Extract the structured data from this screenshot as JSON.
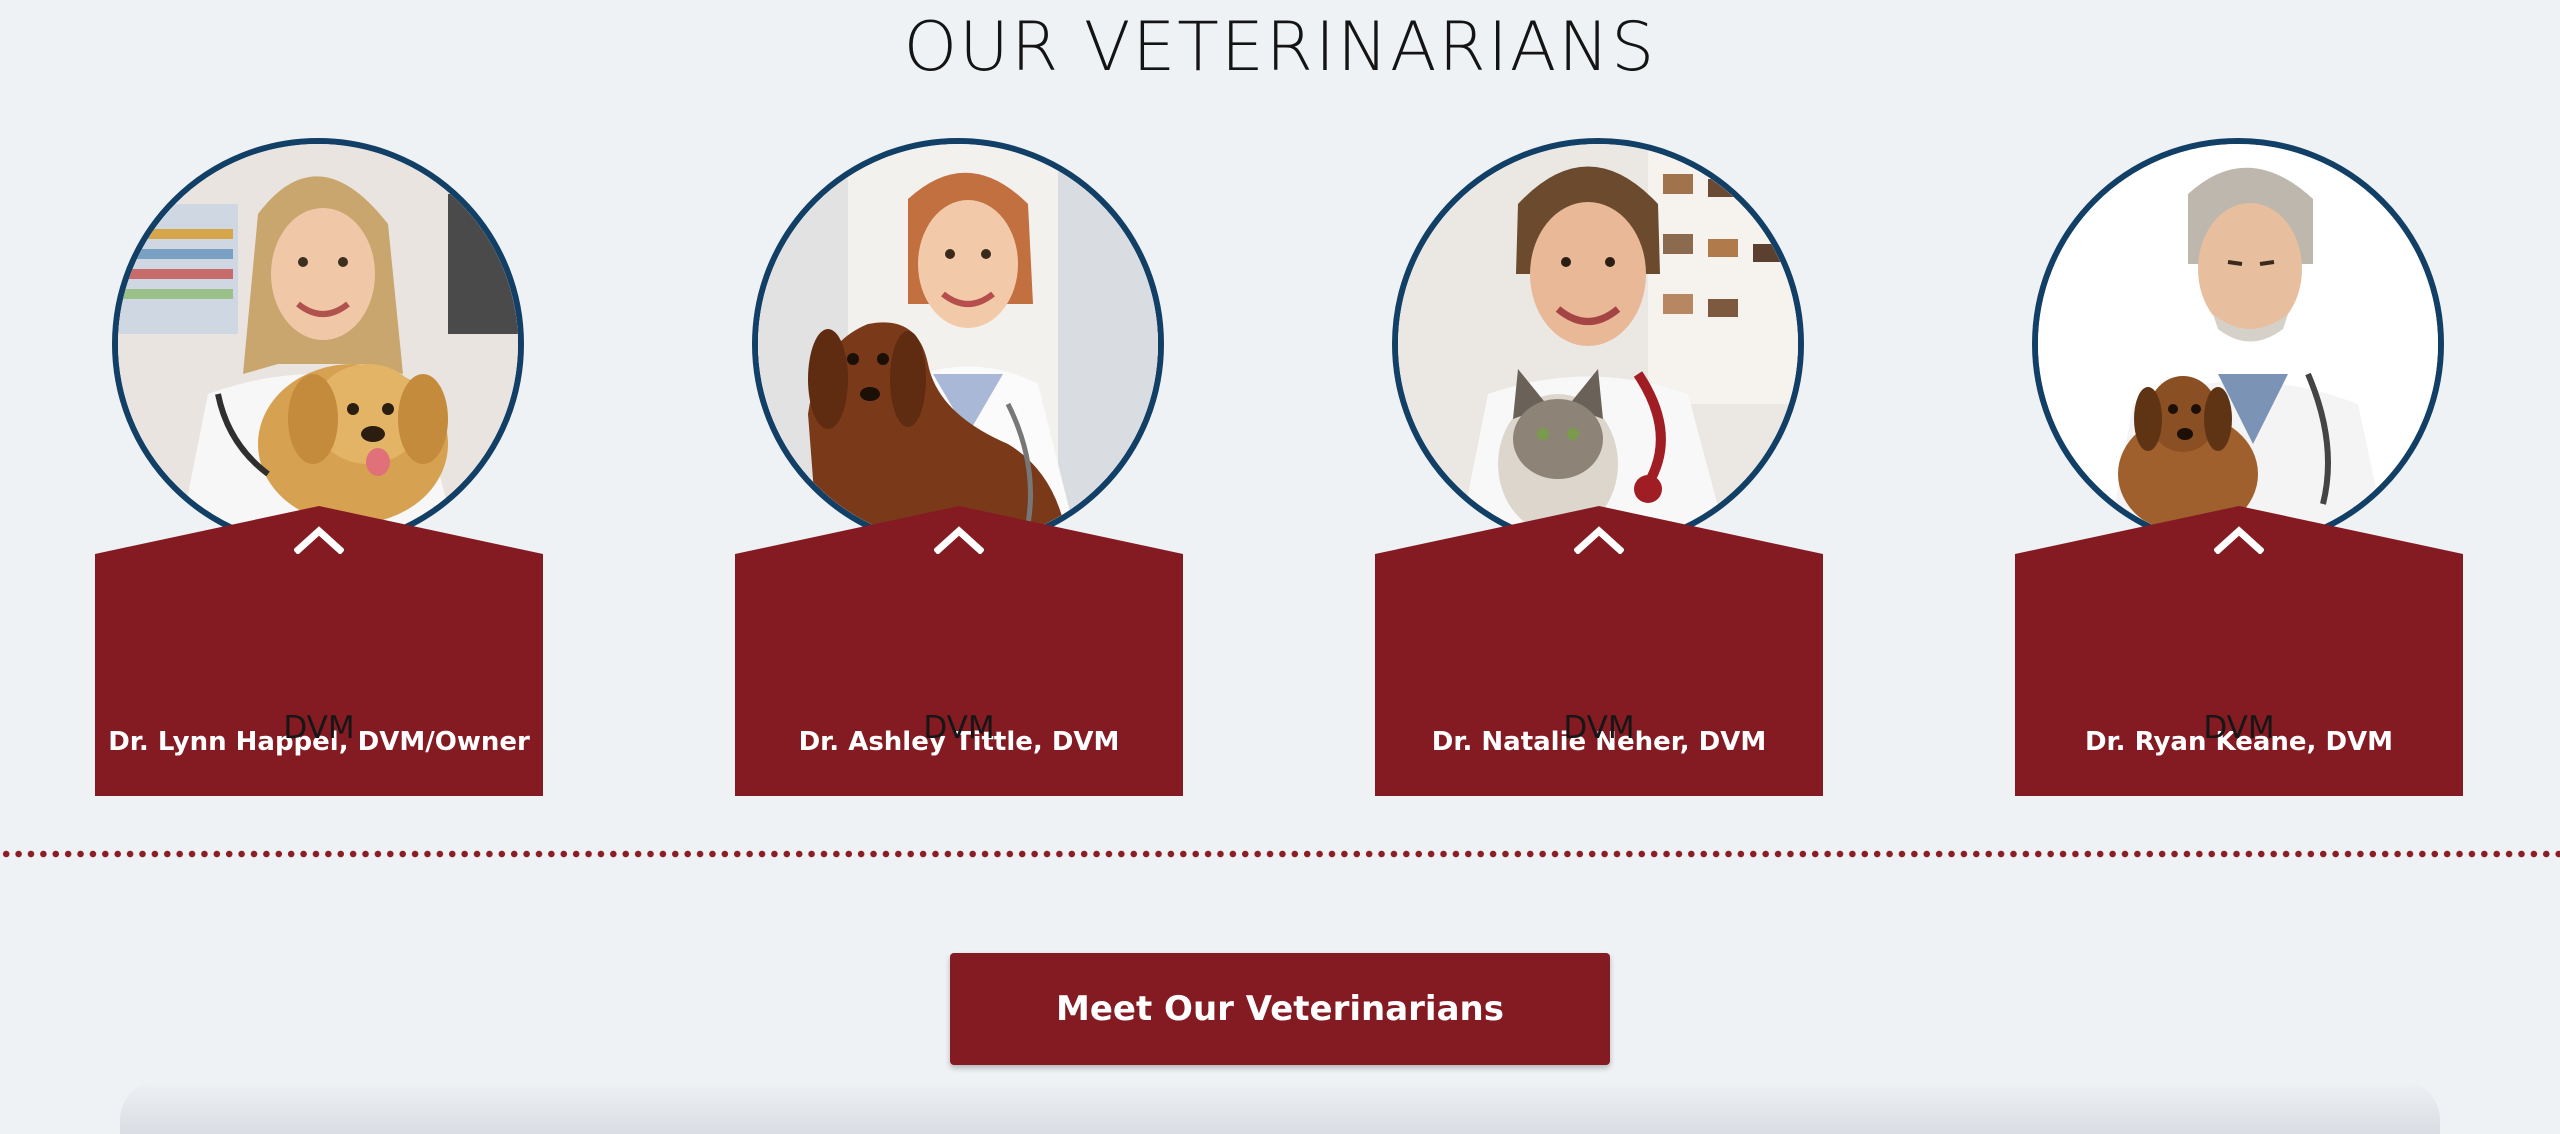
{
  "section": {
    "title": "OUR VETERINARIANS"
  },
  "vets": [
    {
      "name": "Dr. Lynn Happel, DVM/Owner",
      "credential": "DVM",
      "photo_icon": "vet-with-golden-puppy"
    },
    {
      "name": "Dr. Ashley Tittle, DVM",
      "credential": "DVM",
      "photo_icon": "vet-with-dachshund"
    },
    {
      "name": "Dr. Natalie Neher, DVM",
      "credential": "DVM",
      "photo_icon": "vet-with-tabby-cat"
    },
    {
      "name": "Dr. Ryan Keane, DVM",
      "credential": "DVM",
      "photo_icon": "vet-with-small-dog"
    }
  ],
  "cta": {
    "label": "Meet Our Veterinarians"
  },
  "colors": {
    "background": "#eff2f5",
    "brand_red": "#841b23",
    "photo_ring": "#123f66",
    "title_text": "#141414"
  }
}
